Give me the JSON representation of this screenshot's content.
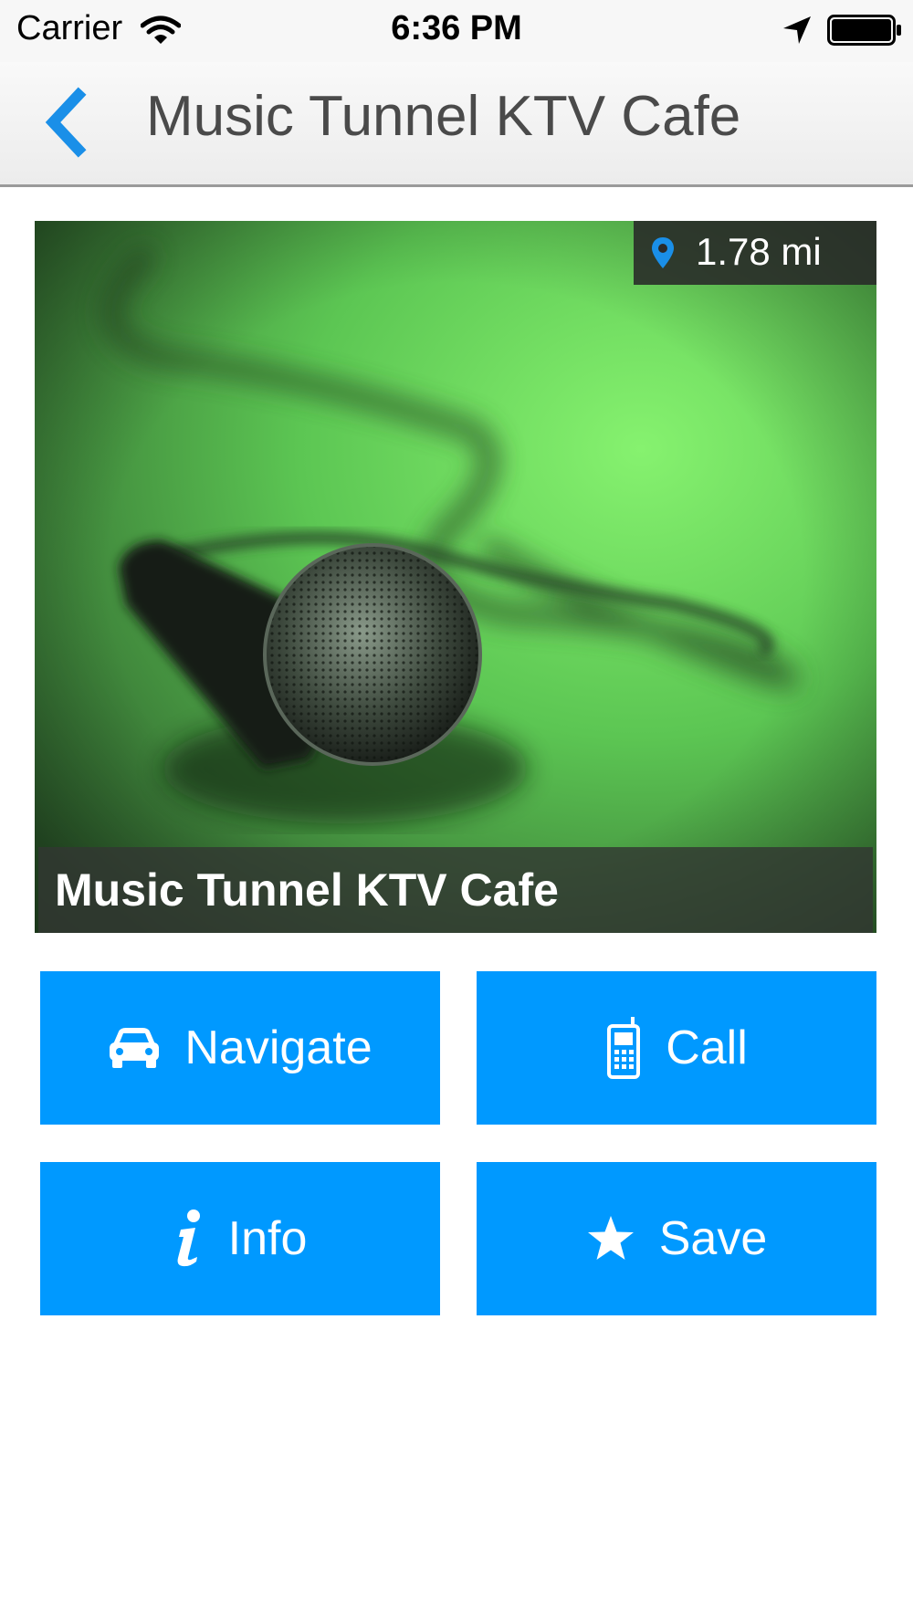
{
  "status_bar": {
    "carrier": "Carrier",
    "time": "6:36 PM"
  },
  "nav_bar": {
    "title": "Music Tunnel KTV Cafe",
    "back_icon": "chevron-left-icon"
  },
  "hero": {
    "image": "microphone-photo",
    "distance": "1.78 mi",
    "caption": "Music Tunnel KTV Cafe"
  },
  "actions": {
    "navigate": {
      "label": "Navigate",
      "icon": "car-icon"
    },
    "call": {
      "label": "Call",
      "icon": "phone-icon"
    },
    "info": {
      "label": "Info",
      "icon": "info-icon"
    },
    "save": {
      "label": "Save",
      "icon": "star-icon"
    }
  },
  "colors": {
    "accent": "#0099ff",
    "button_text": "#ffffff",
    "title_text": "#4a4a4a"
  }
}
